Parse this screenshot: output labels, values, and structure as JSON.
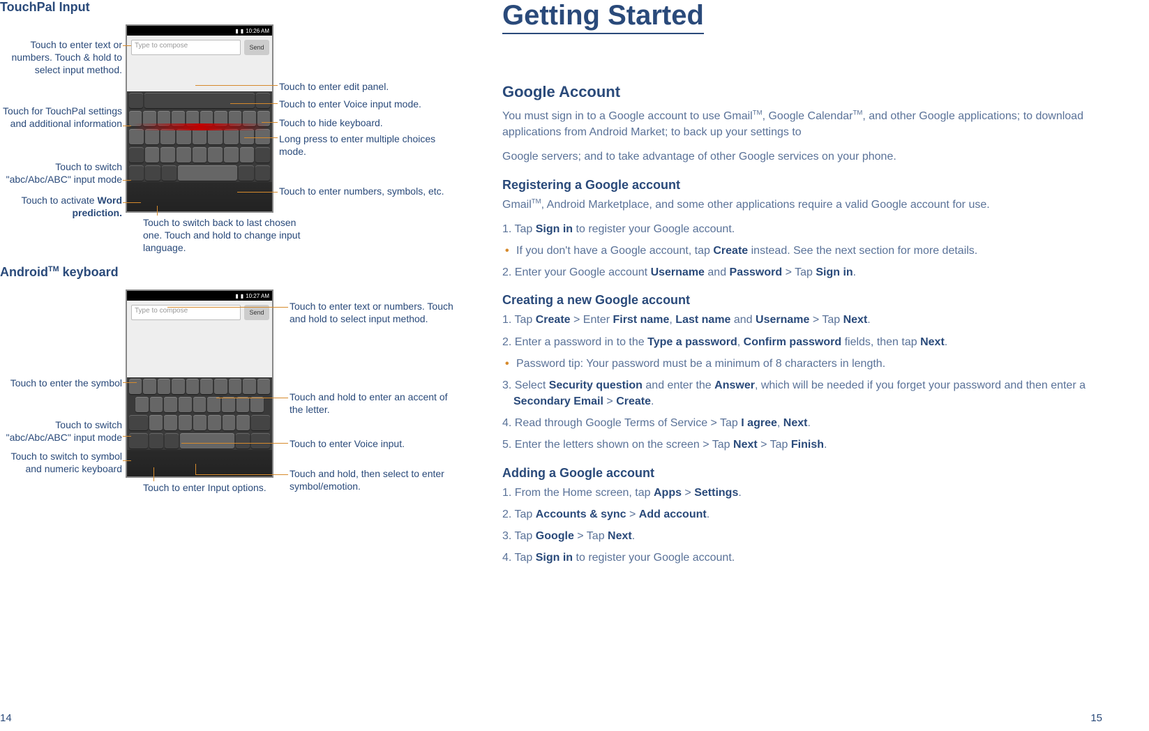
{
  "left": {
    "touchpal_title": "TouchPal Input",
    "android_title": "AndroidTM keyboard",
    "touchpal_labels": {
      "enter_text_hold": "Touch to enter text or numbers. Touch & hold to select input method.",
      "touchpal_settings": "Touch for TouchPal settings and additional information",
      "switch_abc": "Touch to switch \"abc/Abc/ABC\" input mode",
      "word_prediction": "Touch to activate Word prediction.",
      "edit_panel": "Touch to enter edit panel.",
      "voice_input": "Touch to enter Voice input mode.",
      "hide_keyboard": "Touch to hide keyboard.",
      "long_press_multi": "Long press to enter multiple choices mode.",
      "numbers_symbols": "Touch to enter numbers, symbols, etc.",
      "switch_back_lang": "Touch to switch back to last chosen one. Touch and hold to change input language."
    },
    "android_labels": {
      "enter_text_hold": "Touch to enter text or numbers. Touch and hold to select input method.",
      "enter_symbol": "Touch to enter the symbol",
      "switch_abc": "Touch to switch \"abc/Abc/ABC\" input mode",
      "switch_symbol_numeric": "Touch to switch to symbol and numeric keyboard",
      "input_options": "Touch to enter Input options.",
      "accent_letter": "Touch and hold to enter an accent of the letter.",
      "voice_input": "Touch to enter Voice input.",
      "symbol_emotion": "Touch and hold, then select to enter symbol/emotion."
    },
    "page_num": "14"
  },
  "right": {
    "title": "Getting Started",
    "google_account": "Google Account",
    "google_account_p1": "You must sign in to a Google account to use GmailTM, Google CalendarTM, and other Google applications; to download applications from Android Market; to back up your settings to",
    "google_account_p2": "Google servers; and to take advantage of other Google services on your phone.",
    "registering_h": "Registering a Google account",
    "registering_p": "GmailTM, Android Marketplace, and some other applications require a valid Google account for use.",
    "reg_step1": "1. Tap Sign in to register your Google account.",
    "reg_bullet": "If you don't have a Google account, tap Create instead. See the next section for more details.",
    "reg_step2": "2. Enter your Google account Username and Password > Tap Sign in.",
    "creating_h": "Creating a new Google account",
    "create_step1": "1. Tap Create > Enter First name, Last name and Username > Tap Next.",
    "create_step2": "2. Enter a password in to the Type a password, Confirm password fields, then tap Next.",
    "create_bullet": "Password tip: Your password must be a minimum of 8 characters in length.",
    "create_step3": "3. Select Security question and enter the Answer, which will be needed if you forget your password and then enter a Secondary Email > Create.",
    "create_step4": "4. Read through Google Terms of Service > Tap I agree, Next.",
    "create_step5": "5. Enter the letters shown on the screen > Tap Next > Tap Finish.",
    "adding_h": "Adding a Google account",
    "add_step1": "1. From the Home screen, tap Apps > Settings.",
    "add_step2": "2. Tap Accounts & sync > Add account.",
    "add_step3": "3. Tap Google > Tap Next.",
    "add_step4": "4. Tap Sign in to register your Google account.",
    "page_num": "15"
  }
}
